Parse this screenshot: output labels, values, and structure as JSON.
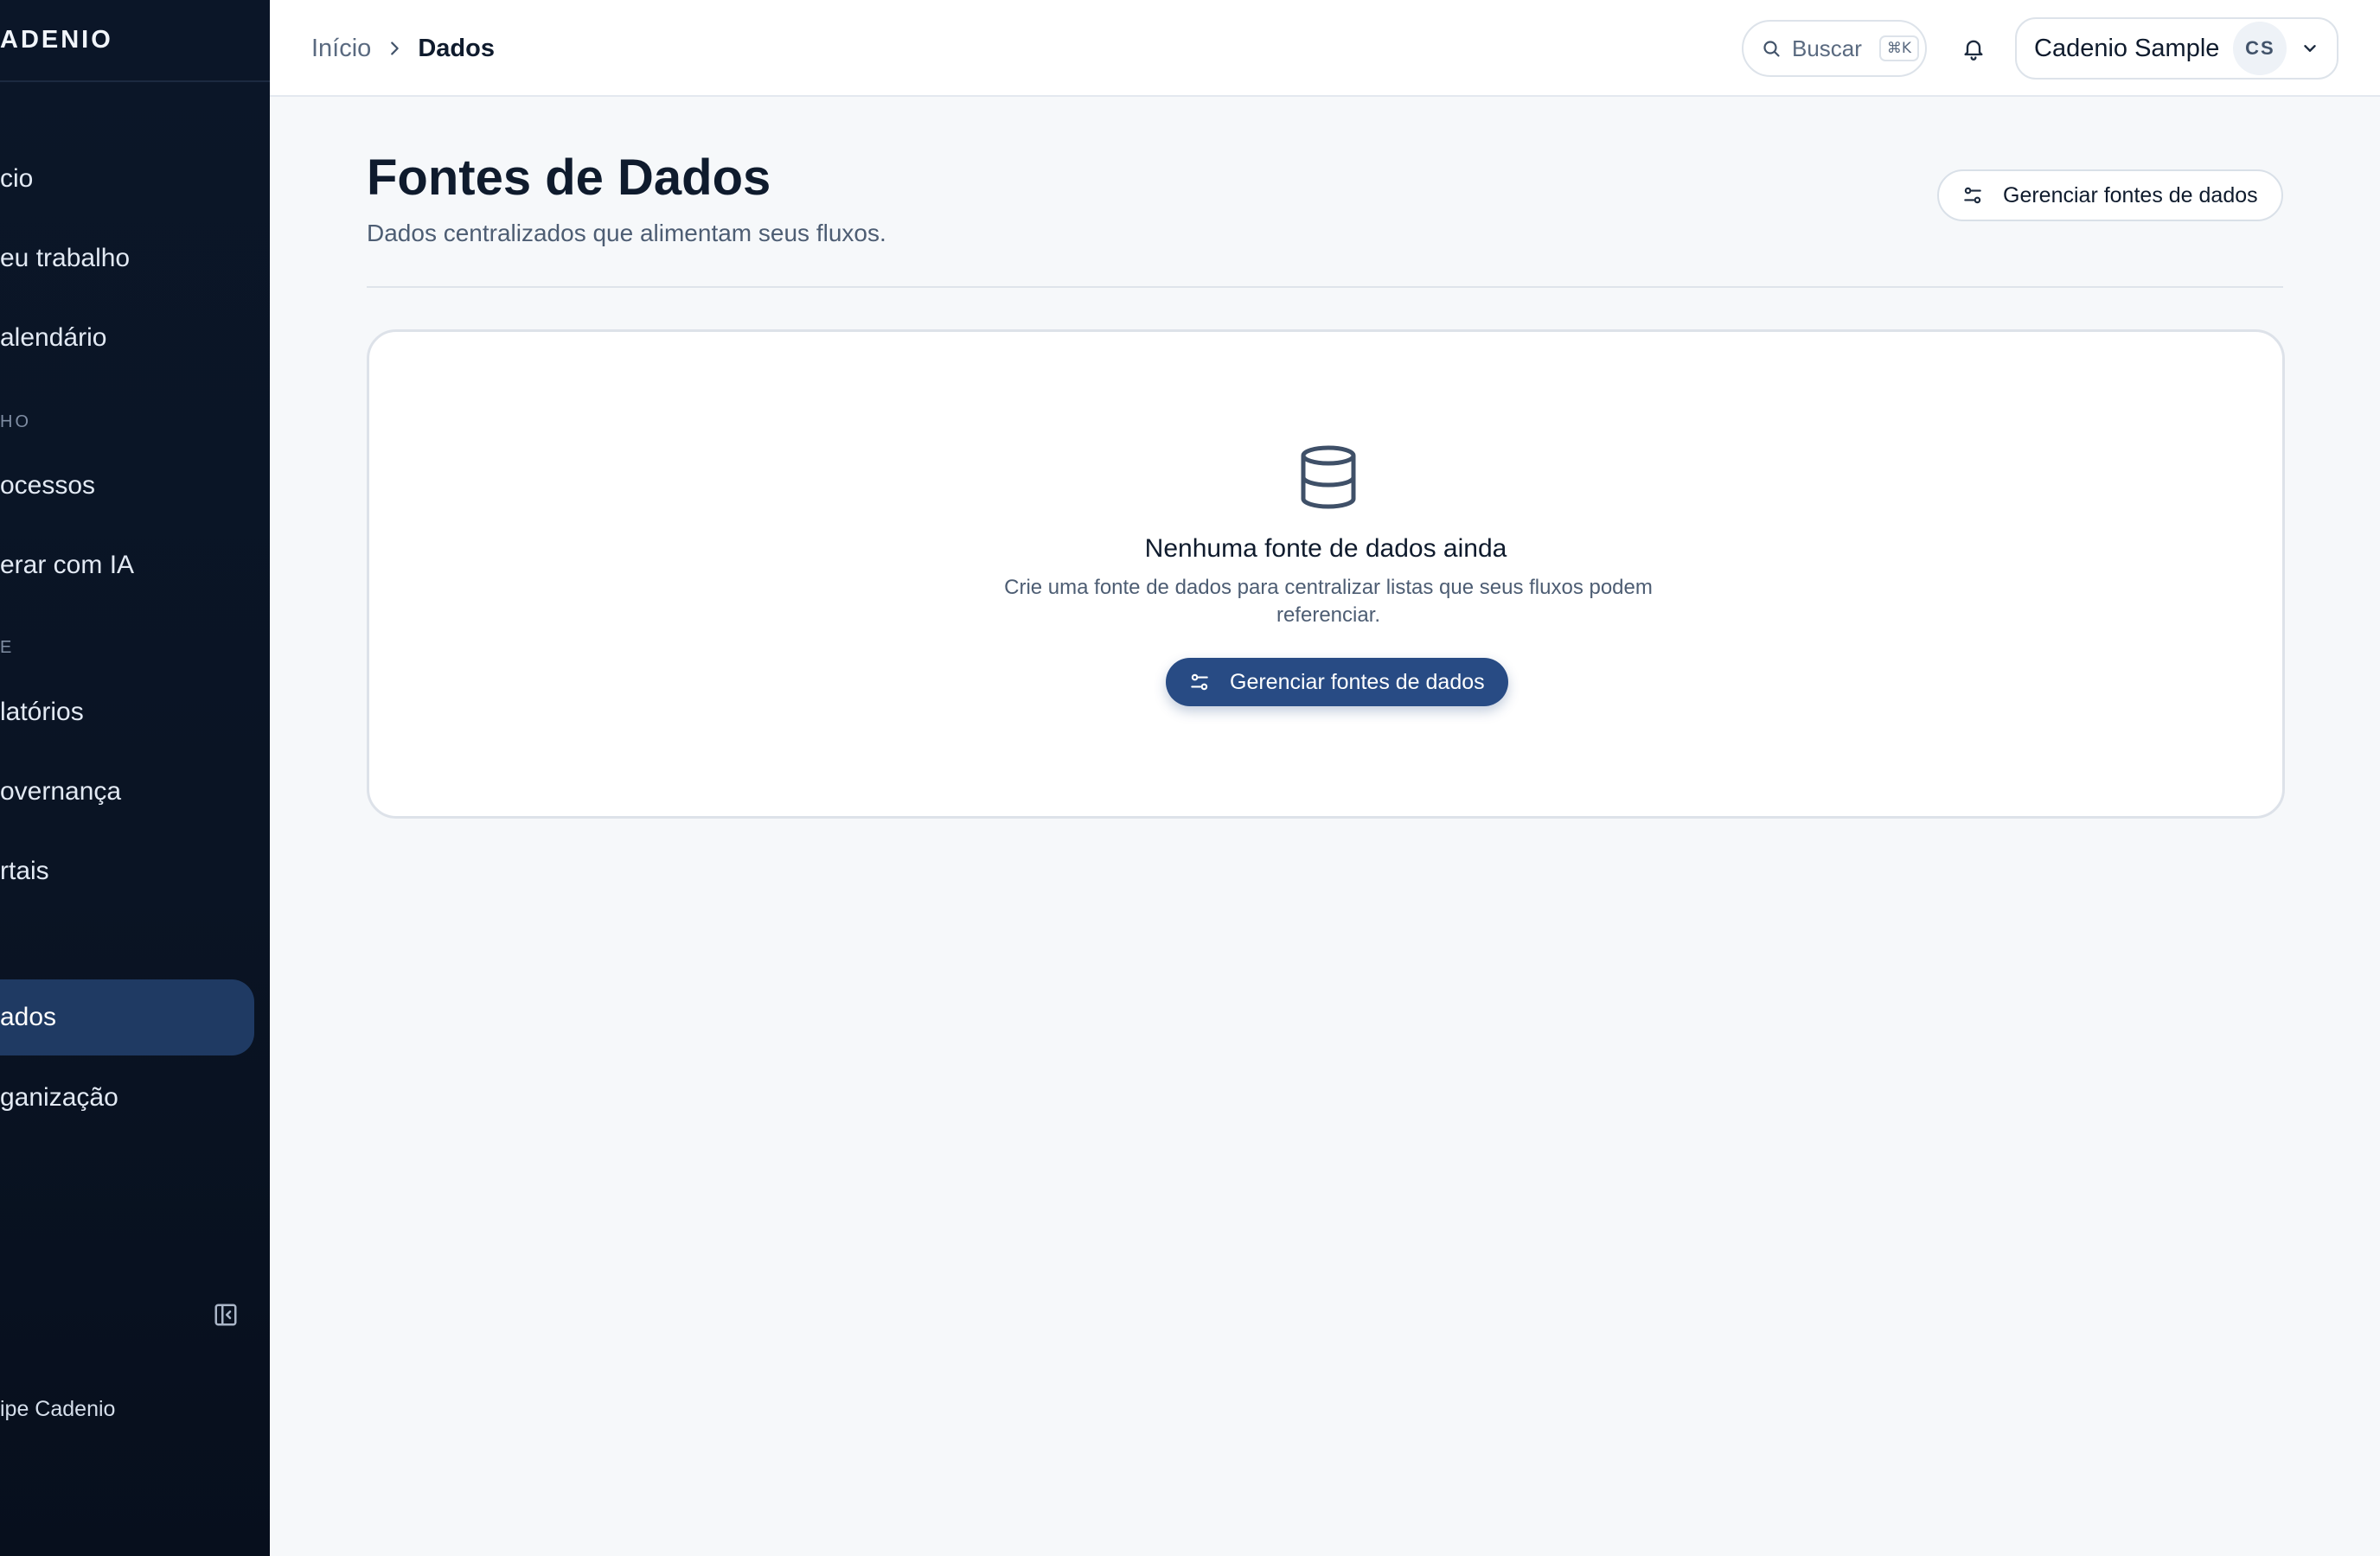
{
  "sidebar": {
    "brand": "ADENIO",
    "items": [
      {
        "label": "cio"
      },
      {
        "label": "eu trabalho"
      },
      {
        "label": "alendário"
      },
      {
        "label": "ocessos"
      },
      {
        "label": "erar com IA"
      },
      {
        "label": "latórios"
      },
      {
        "label": "overnança"
      },
      {
        "label": "rtais"
      },
      {
        "label": "ados"
      },
      {
        "label": "ganização"
      }
    ],
    "sections": [
      "HO",
      "E"
    ],
    "team": "ipe Cadenio"
  },
  "header": {
    "breadcrumb_home": "Início",
    "breadcrumb_current": "Dados",
    "search_label": "Buscar",
    "search_shortcut": "⌘K",
    "user_name": "Cadenio Sample",
    "user_initials": "CS"
  },
  "main": {
    "title": "Fontes de Dados",
    "subtitle": "Dados centralizados que alimentam seus fluxos.",
    "manage_label": "Gerenciar fontes de dados",
    "empty_title": "Nenhuma fonte de dados ainda",
    "empty_desc": "Crie uma fonte de dados para centralizar listas que seus fluxos podem referenciar.",
    "empty_cta": "Gerenciar fontes de dados"
  },
  "colors": {
    "sidebar_bg": "#0b1628",
    "active_item": "#1f3a63",
    "primary": "#284b84",
    "page_bg": "#f6f8fa"
  },
  "icons": [
    "search-icon",
    "bell-icon",
    "chevron-down-icon",
    "chevron-right-icon",
    "sliders-icon",
    "database-icon",
    "sidebar-collapse-icon"
  ]
}
